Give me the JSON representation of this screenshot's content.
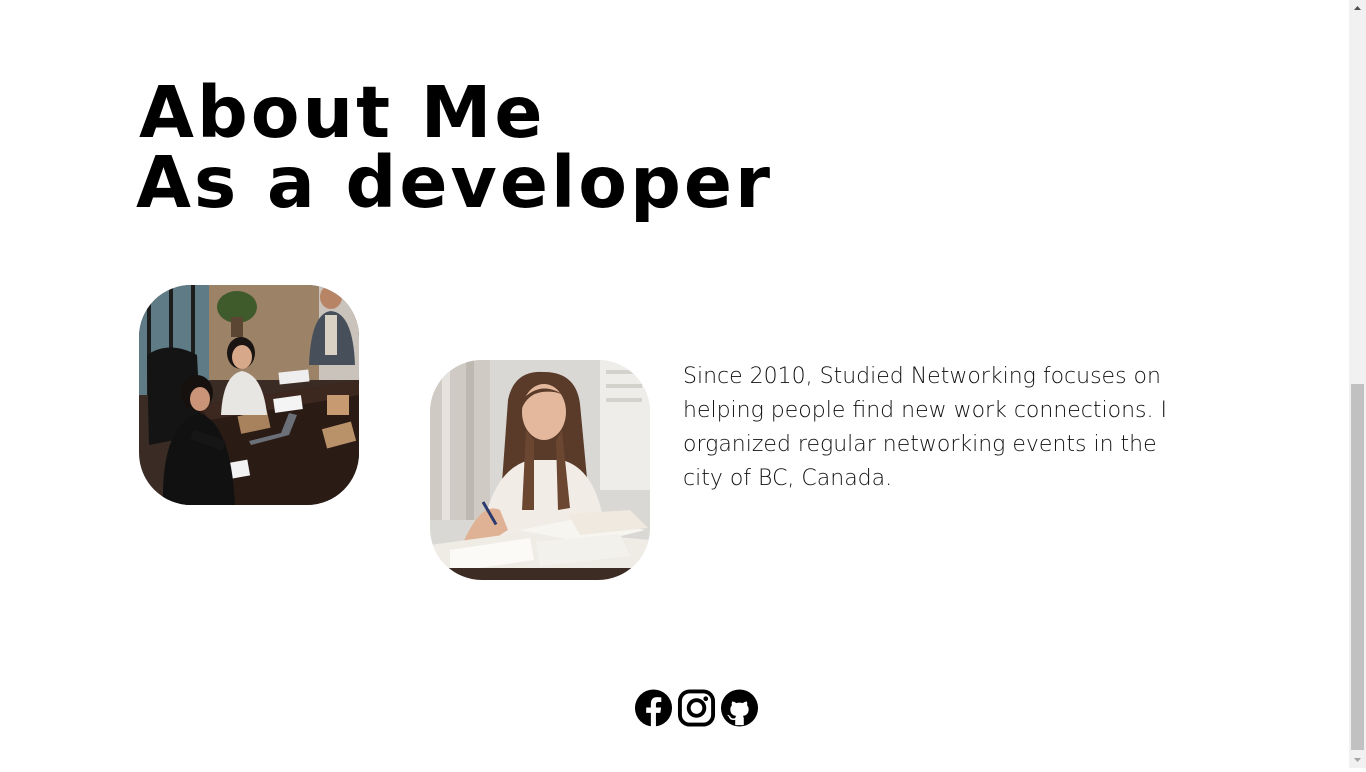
{
  "heading": {
    "line1": "About Me",
    "line2": "As a developer"
  },
  "images": {
    "meeting": "meeting-photo",
    "study": "student-studying-photo"
  },
  "about": {
    "text": "Since 2010, Studied Networking focuses on helping people find new work connections. I organized regular networking events in the city of BC, Canada."
  },
  "social": [
    {
      "icon": "facebook-icon"
    },
    {
      "icon": "instagram-icon"
    },
    {
      "icon": "github-icon"
    }
  ],
  "colors": {
    "background": "#ffffff",
    "text": "#000000",
    "scrollbar_track": "#f1f1f1",
    "scrollbar_thumb": "#c1c1c1"
  }
}
